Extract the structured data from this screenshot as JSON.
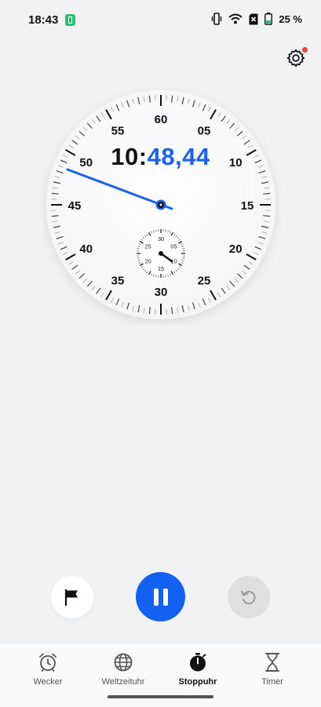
{
  "status": {
    "time": "18:43",
    "battery": "25 %",
    "icons": [
      "notification-icon",
      "vibrate-icon",
      "wifi-icon",
      "sim-off-icon",
      "battery-icon"
    ]
  },
  "settings": {
    "icon": "gear-icon",
    "badge": "notification-dot",
    "badge_color": "#e8453c"
  },
  "stopwatch": {
    "minutes": "10:",
    "seconds": "48,44",
    "main_labels": [
      "60",
      "05",
      "10",
      "15",
      "20",
      "25",
      "30",
      "35",
      "40",
      "45",
      "50",
      "55"
    ],
    "sub_labels": [
      "30",
      "05",
      "10",
      "15",
      "20",
      "25"
    ],
    "accent_color": "#1a63e8"
  },
  "controls": {
    "lap_icon": "flag-icon",
    "pause_icon": "pause-icon",
    "reset_icon": "reset-icon",
    "pause_color": "#1261f0"
  },
  "nav": {
    "items": [
      {
        "label": "Wecker",
        "icon": "alarm-clock-icon"
      },
      {
        "label": "Weltzeituhr",
        "icon": "globe-icon"
      },
      {
        "label": "Stoppuhr",
        "icon": "stopwatch-icon"
      },
      {
        "label": "Timer",
        "icon": "hourglass-icon"
      }
    ],
    "active": "Stoppuhr"
  }
}
